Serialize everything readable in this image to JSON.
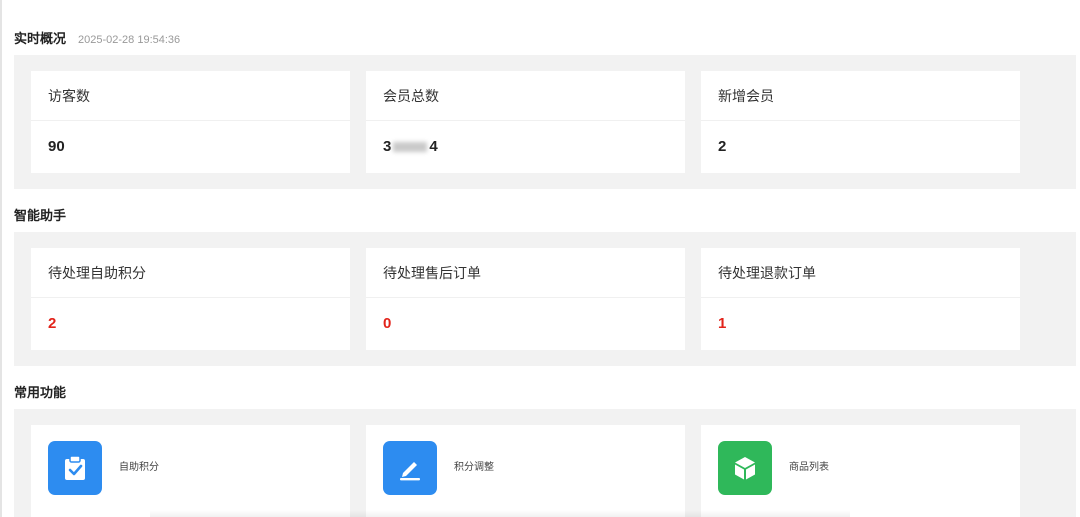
{
  "realtime": {
    "title": "实时概况",
    "timestamp": "2025-02-28 19:54:36",
    "cards": [
      {
        "label": "访客数",
        "value": "90"
      },
      {
        "label": "会员总数",
        "value_prefix": "3",
        "value_suffix": "4"
      },
      {
        "label": "新增会员",
        "value": "2"
      }
    ]
  },
  "assistant": {
    "title": "智能助手",
    "cards": [
      {
        "label": "待处理自助积分",
        "value": "2"
      },
      {
        "label": "待处理售后订单",
        "value": "0"
      },
      {
        "label": "待处理退款订单",
        "value": "1"
      }
    ],
    "value_color": "#e2231a"
  },
  "functions": {
    "title": "常用功能",
    "items": [
      {
        "label": "自助积分",
        "icon": "clipboard-check-icon",
        "color": "#2d8cf0"
      },
      {
        "label": "积分调整",
        "icon": "pencil-edit-icon",
        "color": "#2d8cf0"
      },
      {
        "label": "商品列表",
        "icon": "cube-box-icon",
        "color": "#2fb85a"
      }
    ]
  }
}
